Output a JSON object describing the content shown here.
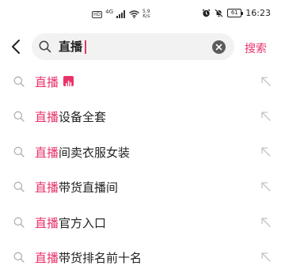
{
  "status_bar": {
    "network_badge": "HD",
    "signal_label": "4G",
    "speed_value": "5.9",
    "speed_unit": "K/s",
    "battery_level": "61",
    "time": "16:23"
  },
  "search": {
    "query": "直播",
    "submit_label": "搜索"
  },
  "suggestions": [
    {
      "highlight": "直播",
      "rest": "",
      "badge": "live-icon"
    },
    {
      "highlight": "直播",
      "rest": "设备全套",
      "badge": null
    },
    {
      "highlight": "直播",
      "rest": "间卖衣服女装",
      "badge": null
    },
    {
      "highlight": "直播",
      "rest": "带货直播间",
      "badge": null
    },
    {
      "highlight": "直播",
      "rest": "官方入口",
      "badge": null
    },
    {
      "highlight": "直播",
      "rest": "带货排名前十名",
      "badge": null
    }
  ],
  "colors": {
    "accent": "#e8336a",
    "text": "#222222",
    "muted_icon": "#b0b0b0",
    "search_bg": "#f2f2f2"
  }
}
